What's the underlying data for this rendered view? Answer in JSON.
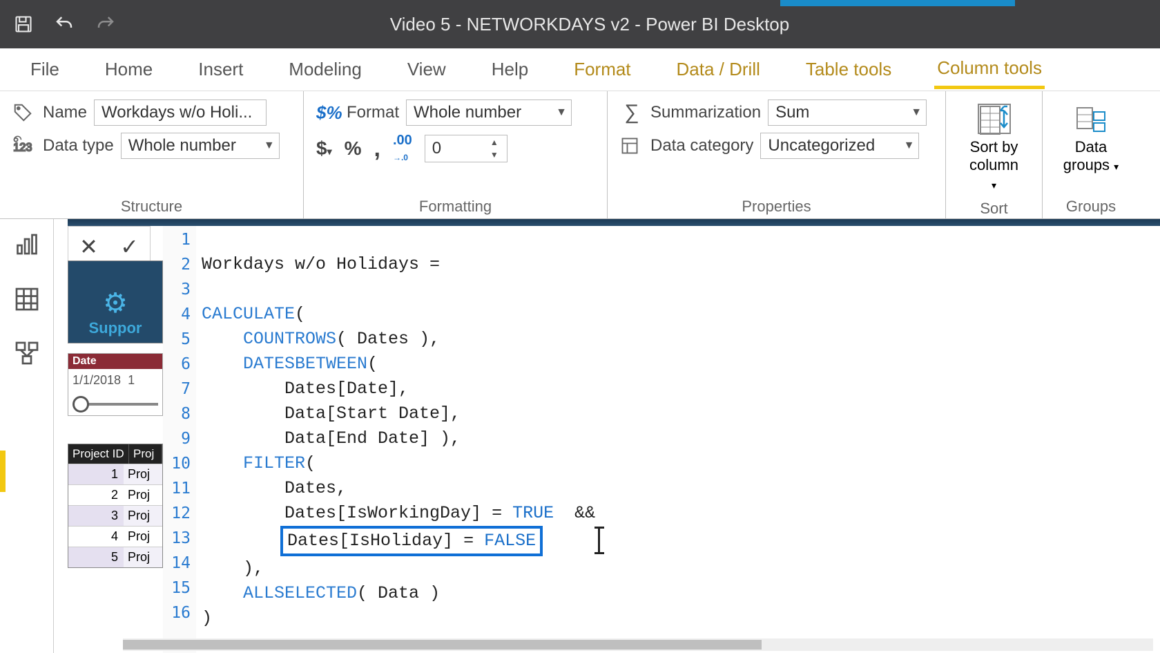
{
  "title": "Video 5 - NETWORKDAYS v2 - Power BI Desktop",
  "tabs": {
    "file": "File",
    "home": "Home",
    "insert": "Insert",
    "modeling": "Modeling",
    "view": "View",
    "help": "Help",
    "format": "Format",
    "datadrill": "Data / Drill",
    "tabletools": "Table tools",
    "columntools": "Column tools"
  },
  "ribbon": {
    "structure": {
      "title": "Structure",
      "name_label": "Name",
      "name_value": "Workdays w/o Holi...",
      "datatype_label": "Data type",
      "datatype_value": "Whole number"
    },
    "formatting": {
      "title": "Formatting",
      "format_label": "Format",
      "format_value": "Whole number",
      "decimals_value": "0"
    },
    "properties": {
      "title": "Properties",
      "summarization_label": "Summarization",
      "summarization_value": "Sum",
      "datacategory_label": "Data category",
      "datacategory_value": "Uncategorized"
    },
    "sort": {
      "title": "Sort",
      "btn": "Sort by\ncolumn"
    },
    "groups": {
      "title": "Groups",
      "btn": "Data\ngroups"
    }
  },
  "canvas": {
    "support_label": "Suppor",
    "slicer_header": "Date",
    "slicer_value": "1/1/2018",
    "table_hdr1": "Project ID",
    "table_hdr2": "Proj",
    "rows": [
      "Proj",
      "Proj",
      "Proj",
      "Proj",
      "Proj"
    ]
  },
  "formula": {
    "lines": {
      "l1": "Workdays w/o Holidays = ",
      "l2": "",
      "l3a": "CALCULATE",
      "l3b": "(",
      "l4a": "    ",
      "l4b": "COUNTROWS",
      "l4c": "( Dates ),",
      "l5a": "    ",
      "l5b": "DATESBETWEEN",
      "l5c": "(",
      "l6": "        Dates[Date],",
      "l7": "        Data[Start Date],",
      "l8": "        Data[End Date] ),",
      "l9a": "    ",
      "l9b": "FILTER",
      "l9c": "(",
      "l10": "        Dates,",
      "l11a": "        Dates[IsWorkingDay] = ",
      "l11b": "TRUE",
      "l11c": "  &&",
      "l12a": "Dates[IsHoliday] = ",
      "l12b": "FALSE",
      "l13": "    ),",
      "l14a": "    ",
      "l14b": "ALLSELECTED",
      "l14c": "( Data )",
      "l15": ")",
      "l16": ""
    }
  }
}
